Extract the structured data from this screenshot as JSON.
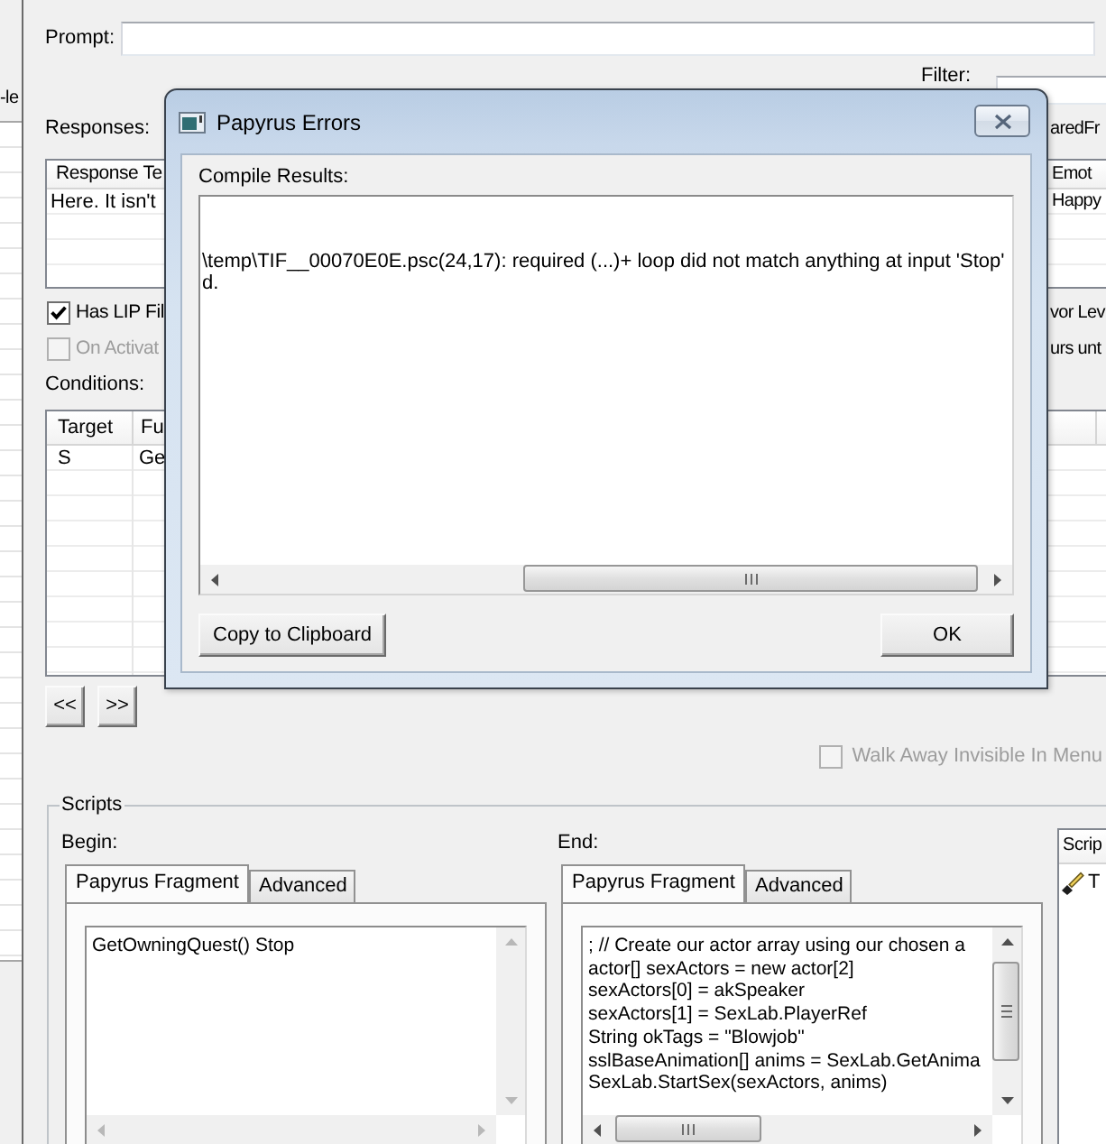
{
  "background_window": {
    "label": "-le"
  },
  "form": {
    "prompt_label": "Prompt:",
    "filter_label": "Filter:",
    "responses_label": "Responses:",
    "shared_label": "aredFr",
    "responses": {
      "columns": [
        "Response Te",
        "Emot"
      ],
      "rows": [
        [
          "Here. It isn't",
          "Happy"
        ]
      ]
    },
    "options": [
      {
        "label": "Has LIP Fil",
        "checked": true,
        "disabled": false
      },
      {
        "label": "On Activat",
        "checked": false,
        "disabled": true
      }
    ],
    "side_labels": [
      "vor Lev",
      "urs unt"
    ],
    "conditions_label": "Conditions:",
    "conditions": {
      "columns": [
        "Target",
        "Fu"
      ],
      "rows": [
        [
          "S",
          "Ge"
        ]
      ]
    },
    "nav_buttons": [
      "<<",
      ">>"
    ],
    "walk_away": {
      "label": "Walk Away Invisible In Menu",
      "checked": false,
      "disabled": true
    },
    "scripts": {
      "title": "Scripts",
      "panes": [
        {
          "label": "Begin:",
          "tabs": [
            {
              "label": "Papyrus Fragment",
              "selected": true
            },
            {
              "label": "Advanced",
              "selected": false
            }
          ],
          "code": [
            "GetOwningQuest() Stop"
          ]
        },
        {
          "label": "End:",
          "tabs": [
            {
              "label": "Papyrus Fragment",
              "selected": true
            },
            {
              "label": "Advanced",
              "selected": false
            }
          ],
          "code": [
            "; // Create our actor array using our chosen a",
            "actor[] sexActors = new actor[2]",
            "sexActors[0] = akSpeaker",
            "sexActors[1] = SexLab.PlayerRef",
            "String okTags = \"Blowjob\"",
            "sslBaseAnimation[] anims = SexLab.GetAnima",
            "SexLab.StartSex(sexActors, anims)"
          ]
        }
      ],
      "script_list": {
        "column": "Scrip",
        "items": [
          "T"
        ]
      }
    }
  },
  "dialog": {
    "title": "Papyrus Errors",
    "results_label": "Compile Results:",
    "results": [
      "\\temp\\TIF__00070E0E.psc(24,17): required (...)+ loop did not match anything at input 'Stop'",
      "d."
    ],
    "buttons": [
      "Copy to Clipboard",
      "OK"
    ]
  }
}
